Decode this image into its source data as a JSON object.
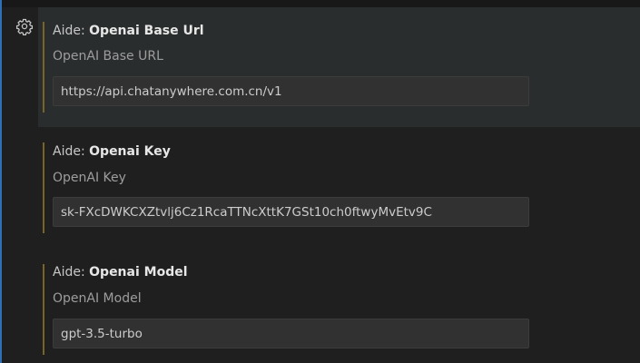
{
  "settings": [
    {
      "category": "Aide:",
      "name": "Openai Base Url",
      "description": "OpenAI Base URL",
      "value": "https://api.chatanywhere.com.cn/v1"
    },
    {
      "category": "Aide:",
      "name": "Openai Key",
      "description": "OpenAI Key",
      "value": "sk-FXcDWKCXZtvlj6Cz1RcaTTNcXttK7GSt10ch0ftwyMvEtv9C"
    },
    {
      "category": "Aide:",
      "name": "Openai Model",
      "description": "OpenAI Model",
      "value": "gpt-3.5-turbo"
    }
  ],
  "colors": {
    "focused_row_bg": "#2a2d2e",
    "modified_bar": "#7a6328",
    "input_bg": "#313131",
    "accent_edge": "#2e6fb8"
  },
  "icons": {
    "settings_gear": "gear-icon"
  }
}
